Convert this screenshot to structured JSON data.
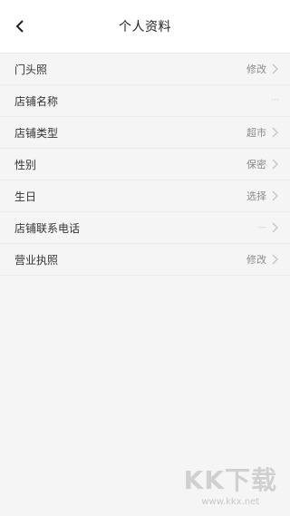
{
  "header": {
    "title": "个人资料",
    "back_icon": "chevron-left-icon"
  },
  "rows": [
    {
      "label": "门头照",
      "value": "修改"
    },
    {
      "label": "店铺名称",
      "value": "···"
    },
    {
      "label": "店铺类型",
      "value": "超市"
    },
    {
      "label": "性别",
      "value": "保密"
    },
    {
      "label": "生日",
      "value": "选择"
    },
    {
      "label": "店铺联系电话",
      "value": "—"
    },
    {
      "label": "营业执照",
      "value": "修改"
    }
  ],
  "watermark": {
    "logo": "KK下载",
    "url": "www.kkx.net"
  }
}
